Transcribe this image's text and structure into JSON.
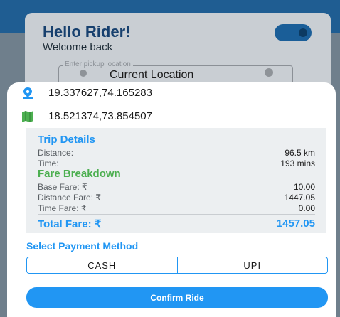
{
  "background": {
    "greeting": "Hello Rider!",
    "subtitle": "Welcome back",
    "pickup_label": "Enter pickup location",
    "pickup_value": "Current Location"
  },
  "locations": [
    {
      "icon": "location-pin-icon",
      "coords": "19.337627,74.165283"
    },
    {
      "icon": "map-icon",
      "coords": "18.521374,73.854507"
    }
  ],
  "trip": {
    "title": "Trip Details",
    "distance_label": "Distance:",
    "distance_value": "96.5 km",
    "time_label": "Time:",
    "time_value": "193 mins"
  },
  "fare": {
    "title": "Fare Breakdown",
    "base_label": "Base Fare: ₹",
    "base_value": "10.00",
    "distance_label": "Distance Fare: ₹",
    "distance_value": "1447.05",
    "time_label": "Time Fare: ₹",
    "time_value": "0.00",
    "total_label": "Total Fare: ₹",
    "total_value": "1457.05"
  },
  "payment": {
    "title": "Select Payment Method",
    "options": [
      "CASH",
      "UPI"
    ]
  },
  "confirm_label": "Confirm Ride",
  "colors": {
    "accent": "#2196f3",
    "fare_heading": "#4caf50",
    "map_icon": "#4caf50"
  }
}
